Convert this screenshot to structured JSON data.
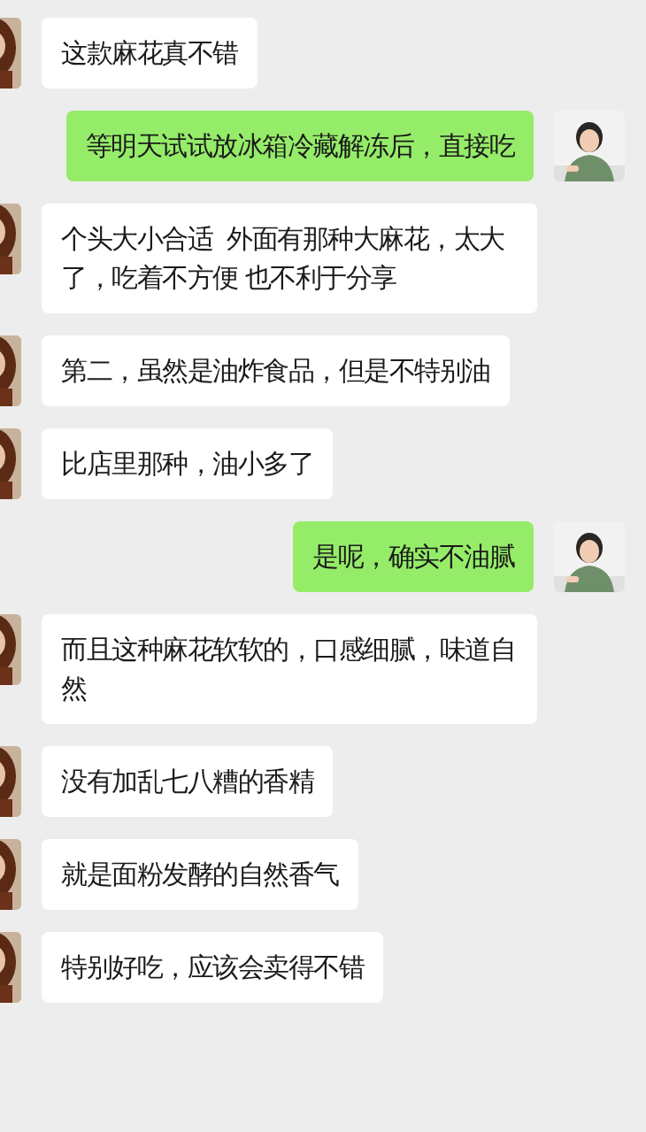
{
  "messages": [
    {
      "outgoing": false,
      "text": "这款麻花真不错"
    },
    {
      "outgoing": true,
      "text": "等明天试试放冰箱冷藏解冻后，直接吃"
    },
    {
      "outgoing": false,
      "text": "个头大小合适  外面有那种大麻花，太大了，吃着不方便 也不利于分享"
    },
    {
      "outgoing": false,
      "text": "第二，虽然是油炸食品，但是不特别油"
    },
    {
      "outgoing": false,
      "text": "比店里那种，油小多了"
    },
    {
      "outgoing": true,
      "text": "是呢，确实不油腻"
    },
    {
      "outgoing": false,
      "text": "而且这种麻花软软的，口感细腻，味道自然"
    },
    {
      "outgoing": false,
      "text": "没有加乱七八糟的香精"
    },
    {
      "outgoing": false,
      "text": "就是面粉发酵的自然香气"
    },
    {
      "outgoing": false,
      "text": "特别好吃，应该会卖得不错"
    }
  ]
}
